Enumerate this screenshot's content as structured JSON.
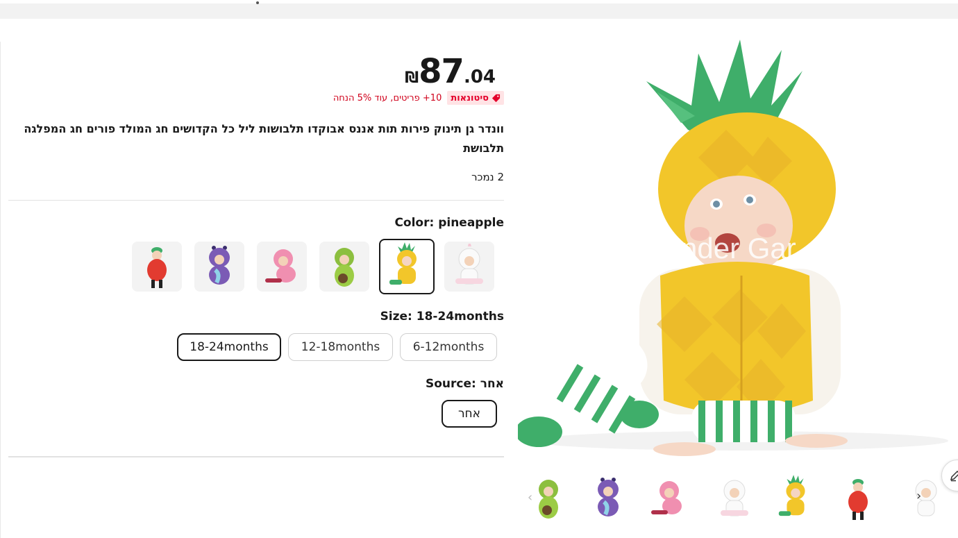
{
  "price": {
    "currency_symbol": "₪",
    "integer": "87",
    "decimal": ".04"
  },
  "promo": {
    "badge_label": "סיטונאות",
    "text": "10+ פריטים, עוד 5% הנחה"
  },
  "product": {
    "title": "וונדר גן תינוק פירות תות אננס אבוקדו תלבושות ליל כל הקדושים חג המולד פורים חג המפלגה תלבושת",
    "sold_count": "2 נמכר"
  },
  "color": {
    "label": "Color: pineapple",
    "options": [
      "unicorn",
      "pineapple",
      "avocado",
      "flamingo",
      "dragon",
      "strawberry"
    ],
    "selected": "pineapple"
  },
  "size": {
    "label": "Size: 18-24months",
    "options": [
      "6-12months",
      "12-18months",
      "18-24months"
    ],
    "selected": "18-24months"
  },
  "source": {
    "label": "Source: אחר",
    "options": [
      "אחר"
    ]
  },
  "gallery": {
    "main_watermark": "nder Gar",
    "thumbnails": [
      "avocado",
      "dragon",
      "flamingo",
      "unicorn",
      "pineapple",
      "strawberry",
      "unicorn"
    ]
  },
  "colors": {
    "promo_red": "#e4002b",
    "text_dark": "#191919",
    "border_light": "#cfcfcf",
    "pineapple_yellow": "#f2c62a",
    "leaf_green": "#3fae6a"
  }
}
